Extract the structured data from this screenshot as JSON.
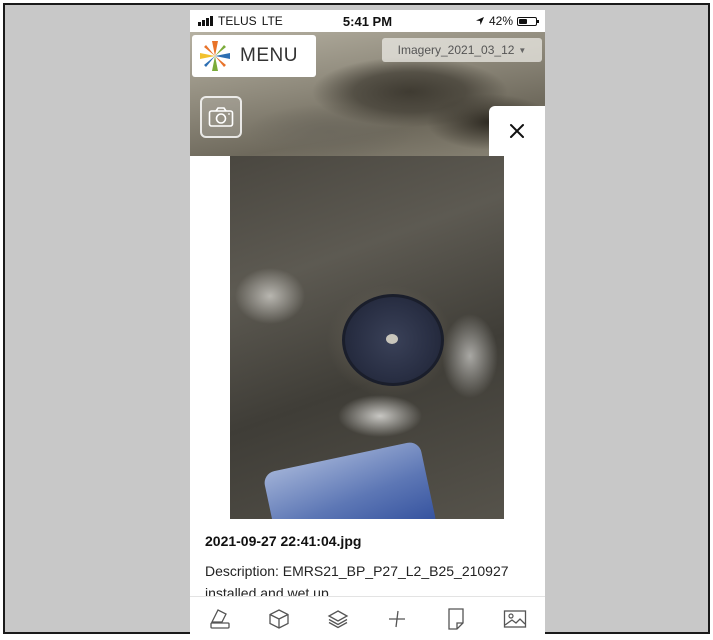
{
  "status_bar": {
    "carrier": "TELUS",
    "network": "LTE",
    "time": "5:41 PM",
    "battery": "42%",
    "battery_level": 0.42
  },
  "header": {
    "menu_label": "MENU",
    "imagery_layer": "Imagery_2021_03_12"
  },
  "photo_panel": {
    "filename": "2021-09-27 22:41:04.jpg",
    "description_line1": "Description: EMRS21_BP_P27_L2_B25_210927",
    "description_line2": "installed and wet up"
  },
  "toolbar": {
    "tools": [
      "erase-icon",
      "box-icon",
      "layers-icon",
      "measure-icon",
      "note-icon",
      "image-icon"
    ]
  },
  "colors": {
    "logo_orange": "#e8732a",
    "logo_green": "#7bab3a",
    "logo_blue": "#2d6fb3",
    "logo_yellow": "#f2c12e",
    "icon_gray": "#555555"
  }
}
